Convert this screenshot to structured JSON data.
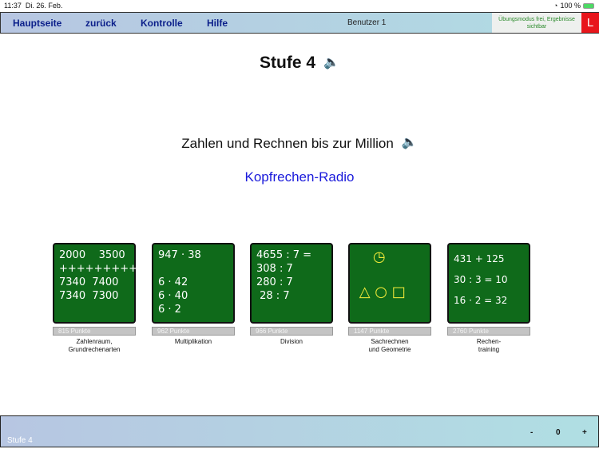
{
  "status": {
    "time": "11:37",
    "date": "Di. 26. Feb.",
    "battery": "100 %"
  },
  "nav": {
    "home": "Hauptseite",
    "back": "zurück",
    "check": "Kontrolle",
    "help": "Hilfe",
    "user": "Benutzer 1",
    "mode": "Übungsmodus frei, Ergebnisse sichtbar",
    "l": "L"
  },
  "title": "Stufe 4",
  "subtitle": "Zahlen und Rechnen bis zur Million",
  "link": "Kopfrechen-Radio",
  "tiles": [
    {
      "chalk": "2000    3500\n+++++++++\n7340  7400\n7340  7300",
      "points": "815 Punkte",
      "caption": "Zahlenraum,\nGrundrechenarten"
    },
    {
      "chalk": "947 · 38\n\n6 · 42\n6 · 40\n6 · 2",
      "points": "962 Punkte",
      "caption": "Multiplikation"
    },
    {
      "chalk": "4655 : 7 =\n308 : 7\n280 : 7\n 28 : 7",
      "points": "966 Punkte",
      "caption": "Division"
    },
    {
      "chalk": "    ◷\n\n △ ○ □",
      "points": "1147 Punkte",
      "caption": "Sachrechnen\nund Geometrie"
    },
    {
      "chalk": "431 + 125\n30 : 3 = 10\n16 · 2 = 32",
      "points": "2760 Punkte",
      "caption": "Rechen-\ntraining"
    }
  ],
  "footer": {
    "label": "Stufe 4",
    "minus": "-",
    "value": "0",
    "plus": "+"
  }
}
